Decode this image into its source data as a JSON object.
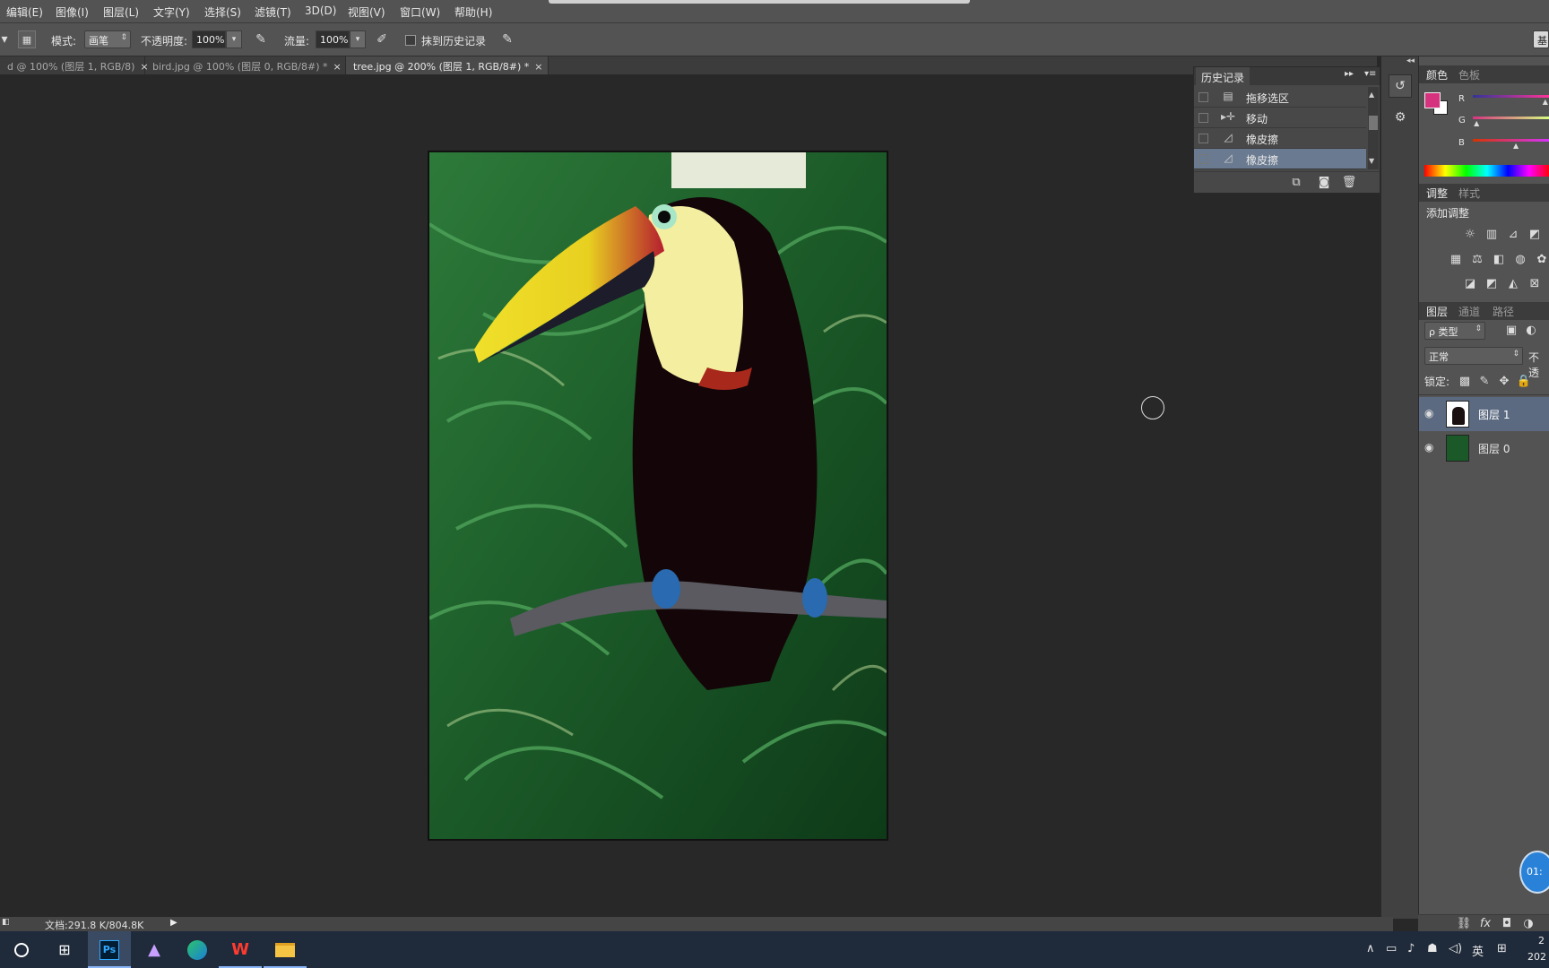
{
  "menu": [
    "编辑(E)",
    "图像(I)",
    "图层(L)",
    "文字(Y)",
    "选择(S)",
    "滤镜(T)",
    "3D(D)",
    "视图(V)",
    "窗口(W)",
    "帮助(H)"
  ],
  "options": {
    "mode_label": "模式:",
    "mode_value": "画笔",
    "opacity_label": "不透明度:",
    "opacity_value": "100%",
    "flow_label": "流量:",
    "flow_value": "100%",
    "erase_history_label": "抹到历史记录",
    "right_btn": "基"
  },
  "tabs": [
    {
      "label": "d @ 100% (图层 1, RGB/8)",
      "close": "×"
    },
    {
      "label": "bird.jpg @ 100% (图层 0, RGB/8#) *",
      "close": "×"
    },
    {
      "label": "tree.jpg @ 200% (图层 1, RGB/8#) *",
      "close": "×"
    }
  ],
  "history": {
    "title": "历史记录",
    "items": [
      {
        "label": "拖移选区",
        "icon": "document-icon",
        "glyph": "▤"
      },
      {
        "label": "移动",
        "icon": "move-tool-icon",
        "glyph": "▸✛"
      },
      {
        "label": "橡皮擦",
        "icon": "eraser-icon",
        "glyph": "◿"
      },
      {
        "label": "橡皮擦",
        "icon": "eraser-icon",
        "glyph": "◿"
      }
    ]
  },
  "color_panel": {
    "tabs": [
      "颜色",
      "色板"
    ],
    "channels": [
      "R",
      "G",
      "B"
    ],
    "levels": [
      0.95,
      0.06,
      0.57
    ],
    "foreground": "#d6337f",
    "background": "#ffffff"
  },
  "adjust_panel": {
    "tabs": [
      "调整",
      "样式"
    ],
    "title": "添加调整"
  },
  "layers_panel": {
    "tabs": [
      "图层",
      "通道",
      "路径"
    ],
    "filter_label": "ρ 类型",
    "blend_mode": "正常",
    "opacity_short": "不透",
    "lock_label": "锁定:",
    "layers": [
      {
        "name": "图层 1",
        "selected": true
      },
      {
        "name": "图层 0",
        "selected": false
      }
    ]
  },
  "status": {
    "doc_info": "文档:291.8 K/804.8K"
  },
  "taskbar": {
    "tray_lang": "英",
    "clock_time": "2",
    "clock_date": "202",
    "floating_badge": "01:"
  }
}
